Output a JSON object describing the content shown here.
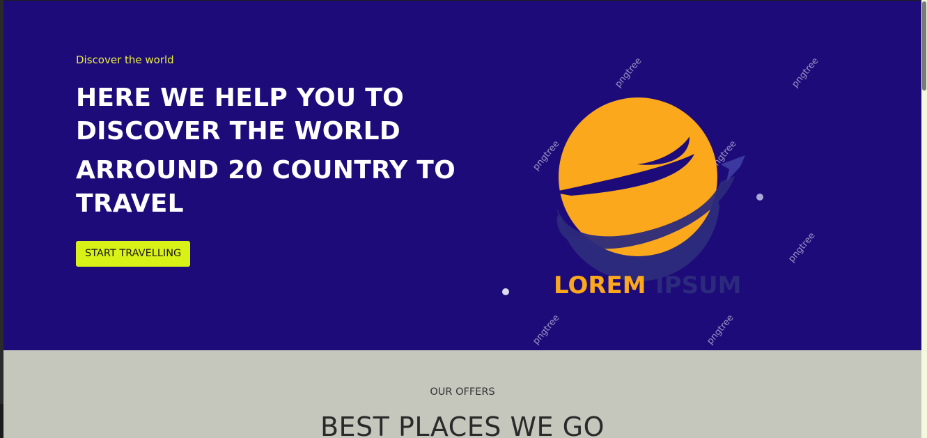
{
  "hero": {
    "eyebrow": "Discover the world",
    "headline_1": "HERE WE HELP YOU TO DISCOVER THE WORLD",
    "headline_2": "ARROUND 20 COUNTRY TO TRAVEL",
    "cta_label": "START TRAVELLING",
    "logo": {
      "word_1": "LOREM",
      "word_2": "IPSUM",
      "watermark": "pngtree"
    }
  },
  "offers": {
    "eyebrow": "OUR OFFERS",
    "title": "BEST PLACES WE GO"
  },
  "colors": {
    "hero_background": "#1e0b7a",
    "eyebrow": "#e9ef3e",
    "cta_background": "#d8f217",
    "planet": "#fba81c",
    "offers_background": "#c5c6bc"
  },
  "icons": {
    "logo": "planet-logo-icon"
  }
}
